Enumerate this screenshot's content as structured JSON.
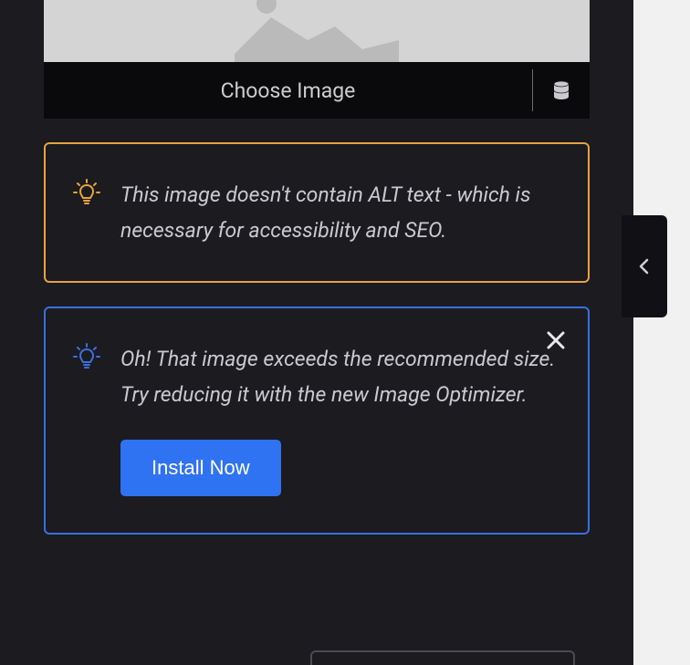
{
  "imagePicker": {
    "chooseLabel": "Choose Image"
  },
  "notices": {
    "warning": {
      "text": "This image doesn't contain ALT text - which is necessary for accessibility and SEO."
    },
    "info": {
      "text": "Oh! That image exceeds the recommended size. Try reducing it with the new Image Optimizer.",
      "ctaLabel": "Install Now"
    }
  }
}
